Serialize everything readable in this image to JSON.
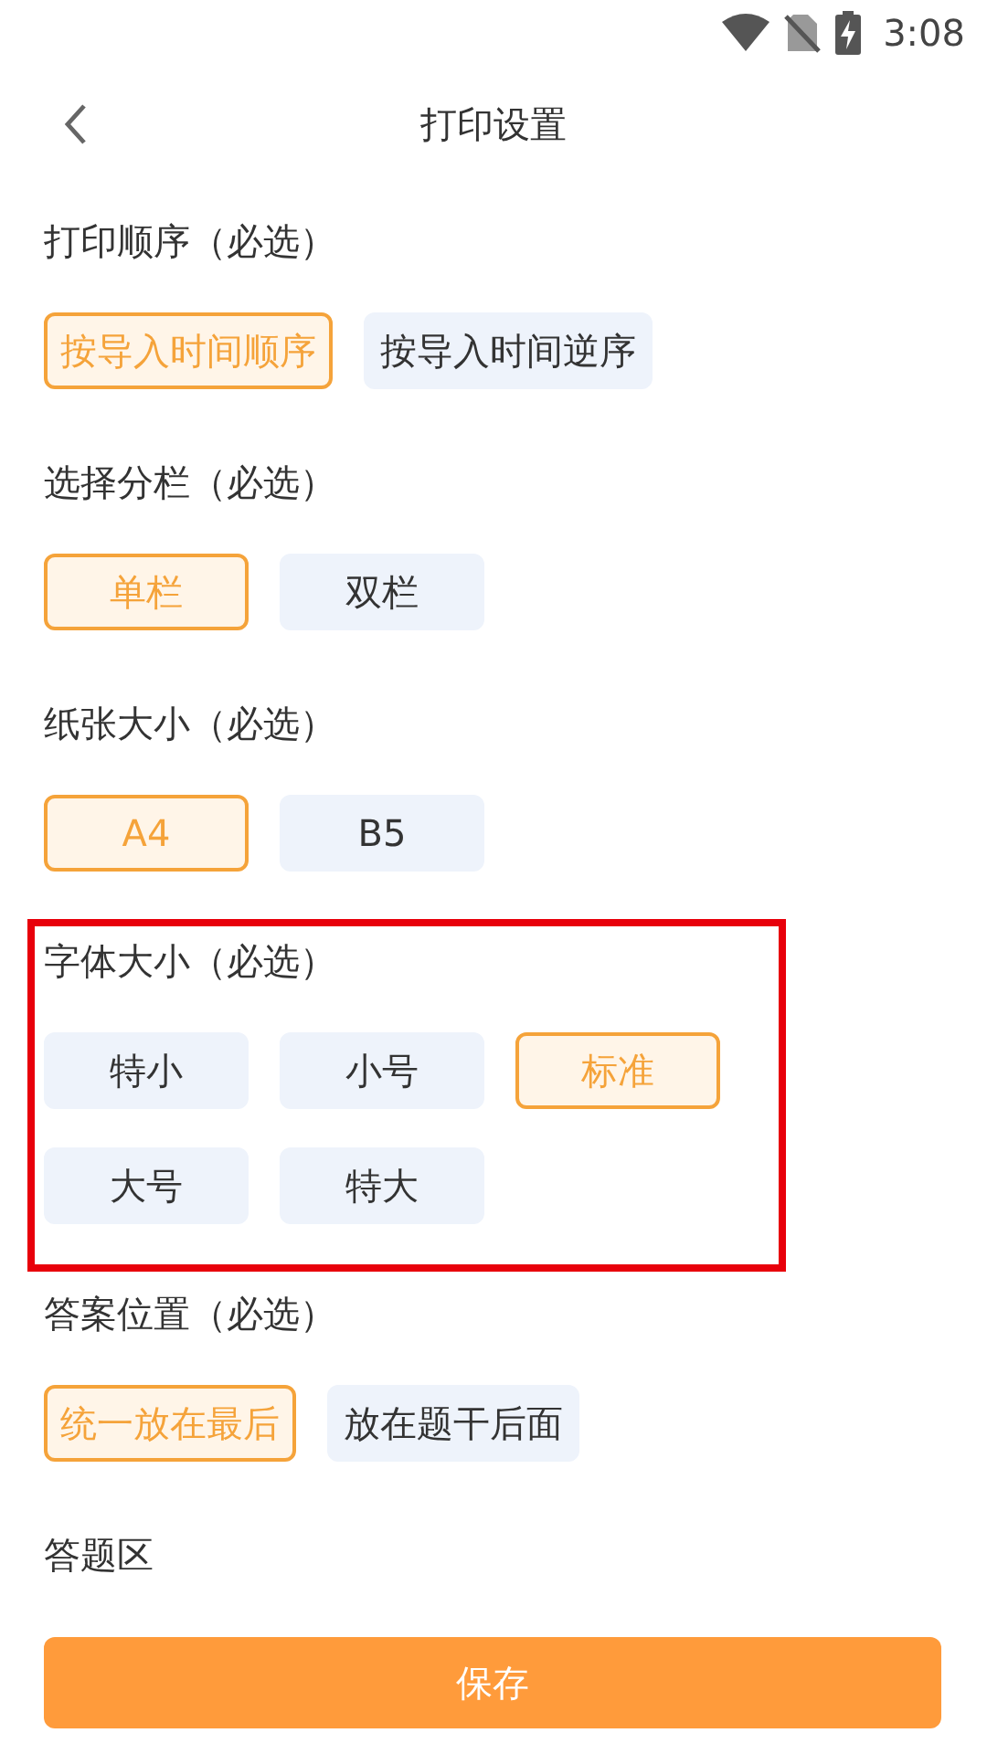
{
  "status_bar": {
    "time": "3:08"
  },
  "header": {
    "title": "打印设置"
  },
  "sections": [
    {
      "title": "打印顺序（必选）",
      "highlighted": false,
      "options": [
        {
          "label": "按导入时间顺序",
          "selected": true
        },
        {
          "label": "按导入时间逆序",
          "selected": false
        }
      ]
    },
    {
      "title": "选择分栏（必选）",
      "highlighted": false,
      "options": [
        {
          "label": "单栏",
          "selected": true
        },
        {
          "label": "双栏",
          "selected": false
        }
      ]
    },
    {
      "title": "纸张大小（必选）",
      "highlighted": false,
      "options": [
        {
          "label": "A4",
          "selected": true
        },
        {
          "label": "B5",
          "selected": false
        }
      ]
    },
    {
      "title": "字体大小（必选）",
      "highlighted": true,
      "options": [
        {
          "label": "特小",
          "selected": false
        },
        {
          "label": "小号",
          "selected": false
        },
        {
          "label": "标准",
          "selected": true
        },
        {
          "label": "大号",
          "selected": false
        },
        {
          "label": "特大",
          "selected": false
        }
      ]
    },
    {
      "title": "答案位置（必选）",
      "highlighted": false,
      "options": [
        {
          "label": "统一放在最后",
          "selected": true
        },
        {
          "label": "放在题干后面",
          "selected": false
        }
      ]
    },
    {
      "title": "答题区",
      "highlighted": false
    }
  ],
  "save_button": {
    "label": "保存"
  }
}
